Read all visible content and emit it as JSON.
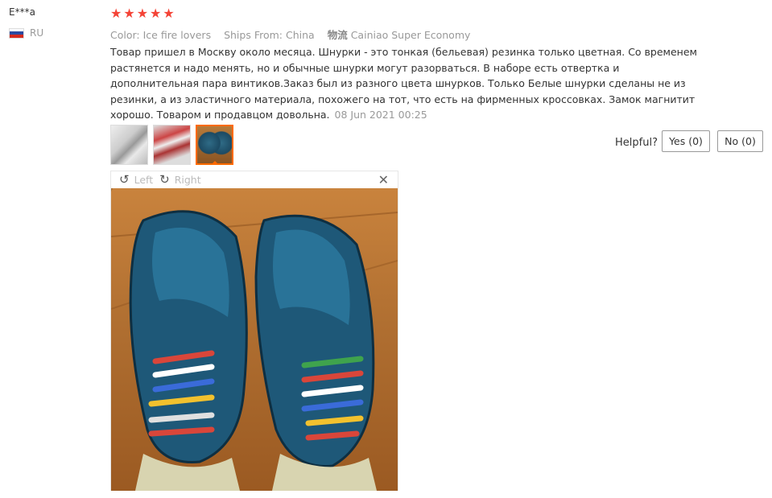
{
  "reviewer": {
    "name": "E***a",
    "country_code": "RU",
    "flag_colors": [
      "#ffffff",
      "#2b4aa0",
      "#d52b1e"
    ]
  },
  "rating": {
    "stars": 5,
    "max": 5,
    "star_color": "#f44336"
  },
  "meta": {
    "color": "Color: Ice fire lovers",
    "ships_from": "Ships From: China",
    "logistics_glyph": "物流",
    "logistics": "Cainiao Super Economy"
  },
  "review": {
    "text": "Товар пришел в Москву около месяца. Шнурки - это тонкая (бельевая) резинка только цветная. Со временем растянется и надо менять, но и обычные шнурки могут разорваться. В наборе есть отвертка и дополнительная пара винтиков.Заказ был из разного цвета шнурков. Только Белые шнурки сделаны не из резинки, а из эластичного материала, похожего на тот, что есть на фирменных кроссовках. Замок магнитит хорошо. Товаром и продавцом довольна.",
    "date": "08 Jun 2021 00:25"
  },
  "thumbnails": [
    {
      "label": "thumbnail-1",
      "active": false
    },
    {
      "label": "thumbnail-2",
      "active": false
    },
    {
      "label": "thumbnail-3",
      "active": true
    }
  ],
  "helpful": {
    "label": "Helpful?",
    "yes": "Yes (0)",
    "no": "No (0)"
  },
  "viewer": {
    "rotate_left": "Left",
    "rotate_right": "Right",
    "close": "✕"
  },
  "colors": {
    "accent": "#ff6a00",
    "muted": "#999999"
  }
}
